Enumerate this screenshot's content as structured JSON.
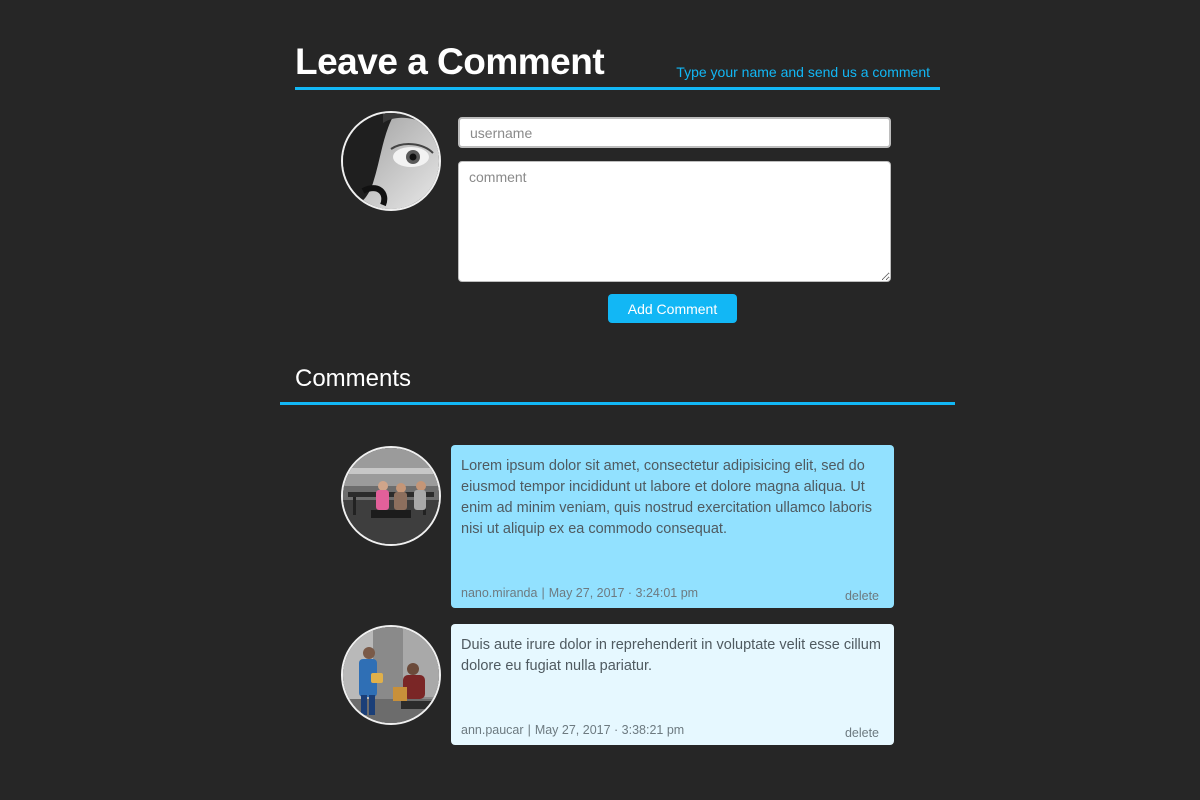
{
  "form": {
    "title": "Leave a Comment",
    "subtitle": "Type your name and send us a comment",
    "username_placeholder": "username",
    "comment_placeholder": "comment",
    "submit_label": "Add Comment",
    "avatar_icon": "user-avatar-photo"
  },
  "comments_section": {
    "title": "Comments",
    "items": [
      {
        "text": "Lorem ipsum dolor sit amet, consectetur adipisicing elit, sed do eiusmod tempor incididunt ut labore et dolore magna aliqua. Ut enim ad minim veniam, quis nostrud exercitation ullamco laboris nisi ut aliquip ex ea commodo consequat.",
        "author": "nano.miranda",
        "separator": "|",
        "date": "May 27, 2017 · 3:24:01 pm",
        "delete_label": "delete",
        "background": "#92e1ff"
      },
      {
        "text": "Duis aute irure dolor in reprehenderit in voluptate velit esse cillum dolore eu fugiat nulla pariatur.",
        "author": "ann.paucar",
        "separator": "|",
        "date": "May 27, 2017 · 3:38:21 pm",
        "delete_label": "delete",
        "background": "#e6f8ff"
      }
    ]
  },
  "colors": {
    "background": "#262626",
    "accent": "#12b7f5",
    "text_light": "#ffffff"
  }
}
